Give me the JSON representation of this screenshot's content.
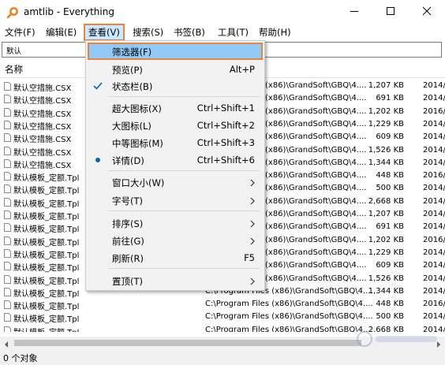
{
  "window": {
    "title": "amtlib - Everything"
  },
  "menubar": {
    "items": [
      {
        "label": "文件(F)"
      },
      {
        "label": "编辑(E)"
      },
      {
        "label": "查看(V)"
      },
      {
        "label": "搜索(S)"
      },
      {
        "label": "书签(B)"
      },
      {
        "label": "工具(T)"
      },
      {
        "label": "帮助(H)"
      }
    ],
    "active_index": 2
  },
  "search": {
    "value": "默认"
  },
  "list": {
    "column_name": "名称",
    "rows": [
      {
        "name": "默认空措施.CSX",
        "path": "",
        "size": "1,207 KB",
        "date": "2014/"
      },
      {
        "name": "默认空措施.CSX",
        "path": "",
        "size": "691 KB",
        "date": "2014/"
      },
      {
        "name": "默认空措施.CSX",
        "path": "",
        "size": "1,202 KB",
        "date": "2016/"
      },
      {
        "name": "默认空措施.CSX",
        "path": "",
        "size": "1,229 KB",
        "date": "2014/"
      },
      {
        "name": "默认空措施.CSX",
        "path": "",
        "size": "609 KB",
        "date": "2014/"
      },
      {
        "name": "默认空措施.CSX",
        "path": "",
        "size": "1,526 KB",
        "date": "2014/"
      },
      {
        "name": "默认空措施.CSX",
        "path": "",
        "size": "1,344 KB",
        "date": "2014/"
      },
      {
        "name": "默认模板_定额.Tpl",
        "path": "",
        "size": "448 KB",
        "date": "2016/"
      },
      {
        "name": "默认模板_定额.Tpl",
        "path": "",
        "size": "500 KB",
        "date": "2014/"
      },
      {
        "name": "默认模板_定额.Tpl",
        "path": "",
        "size": "2,668 KB",
        "date": "2014/"
      },
      {
        "name": "默认模板_定额.Tpl",
        "path": "",
        "size": "1,207 KB",
        "date": "2014/"
      },
      {
        "name": "默认模板_定额.Tpl",
        "path": "",
        "size": "691 KB",
        "date": "2014/"
      },
      {
        "name": "默认模板_定额.Tpl",
        "path": "",
        "size": "1,202 KB",
        "date": "2016/"
      },
      {
        "name": "默认模板_定额.Tpl",
        "path": "",
        "size": "1,229 KB",
        "date": "2014/"
      },
      {
        "name": "默认模板_定额.Tpl",
        "path": "",
        "size": "609 KB",
        "date": "2014/"
      },
      {
        "name": "默认模板_定额.Tpl",
        "path": "",
        "size": "1,526 KB",
        "date": "2014/"
      },
      {
        "name": "默认模板_定额.Tpl",
        "path": "C:\\Program Files (x86)\\GrandSoft\\GBQ\\4....",
        "size": "1,344 KB",
        "date": "2014/"
      },
      {
        "name": "默认模板_定额.Tpl",
        "path": "C:\\Program Files (x86)\\GrandSoft\\GBQ\\4....",
        "size": "448 KB",
        "date": "2016/"
      },
      {
        "name": "默认模板_定额.Tpl",
        "path": "C:\\Program Files (x86)\\GrandSoft\\GBQ\\4....",
        "size": "500 KB",
        "date": "2014/"
      },
      {
        "name": "默认模板_定额.Tpl",
        "path": "C:\\Program Files (x86)\\GrandSoft\\GBQ\\4....",
        "size": "2,668 KB",
        "date": "2014/"
      }
    ],
    "path_fragment_rows": [
      {
        "path": "(x86)\\GrandSoft\\GBQ\\4...."
      },
      {
        "path": "(x86)\\GrandSoft\\GBQ\\4...."
      },
      {
        "path": "(x86)\\GrandSoft\\GBQ\\4...."
      },
      {
        "path": "(x86)\\GrandSoft\\GBQ\\4...."
      },
      {
        "path": "(x86)\\GrandSoft\\GBQ\\4...."
      },
      {
        "path": "(x86)\\GrandSoft\\GBQ\\4...."
      },
      {
        "path": "(x86)\\GrandSoft\\GBQ\\4...."
      },
      {
        "path": "(x86)\\GrandSoft\\GBQ\\4...."
      },
      {
        "path": "(x86)\\GrandSoft\\GBQ\\4...."
      },
      {
        "path": "(x86)\\GrandSoft\\GBQ\\4...."
      },
      {
        "path": "(x86)\\GrandSoft\\GBQ\\4...."
      },
      {
        "path": "(x86)\\GrandSoft\\GBQ\\4...."
      },
      {
        "path": "(x86)\\GrandSoft\\GBQ\\4...."
      },
      {
        "path": "(x86)\\GrandSoft\\GBQ\\4...."
      },
      {
        "path": "(x86)\\GrandSoft\\GBQ\\4...."
      },
      {
        "path": "(x86)\\GrandSoft\\GBQ\\4...."
      }
    ]
  },
  "view_menu": {
    "items": [
      {
        "label": "筛选器(F)",
        "shortcut": "",
        "check": "none",
        "submenu": false,
        "highlight": true
      },
      {
        "label": "预览(P)",
        "shortcut": "Alt+P",
        "check": "none",
        "submenu": false
      },
      {
        "label": "状态栏(B)",
        "shortcut": "",
        "check": "check",
        "submenu": false
      },
      {
        "label": "超大图标(X)",
        "shortcut": "Ctrl+Shift+1",
        "check": "none",
        "submenu": false
      },
      {
        "label": "大图标(L)",
        "shortcut": "Ctrl+Shift+2",
        "check": "none",
        "submenu": false
      },
      {
        "label": "中等图标(M)",
        "shortcut": "Ctrl+Shift+3",
        "check": "none",
        "submenu": false
      },
      {
        "label": "详情(D)",
        "shortcut": "Ctrl+Shift+6",
        "check": "dot",
        "submenu": false
      },
      {
        "label": "窗口大小(W)",
        "shortcut": "",
        "check": "none",
        "submenu": true
      },
      {
        "label": "字号(T)",
        "shortcut": "",
        "check": "none",
        "submenu": true
      },
      {
        "label": "排序(S)",
        "shortcut": "",
        "check": "none",
        "submenu": true
      },
      {
        "label": "前往(G)",
        "shortcut": "",
        "check": "none",
        "submenu": true
      },
      {
        "label": "刷新(R)",
        "shortcut": "F5",
        "check": "none",
        "submenu": false
      },
      {
        "label": "置顶(T)",
        "shortcut": "",
        "check": "none",
        "submenu": true
      }
    ]
  },
  "status": {
    "text": "0 个对象"
  },
  "colors": {
    "accent_outline": "#e8843c",
    "highlight": "#91c9f7",
    "check": "#0067c0"
  },
  "icons": {
    "app": "magnifier-icon",
    "minimize": "minimize-icon",
    "maximize": "maximize-icon",
    "close": "close-icon",
    "file": "file-icon",
    "check": "check-icon",
    "dot": "radio-dot-icon",
    "submenu": "chevron-right-icon"
  }
}
